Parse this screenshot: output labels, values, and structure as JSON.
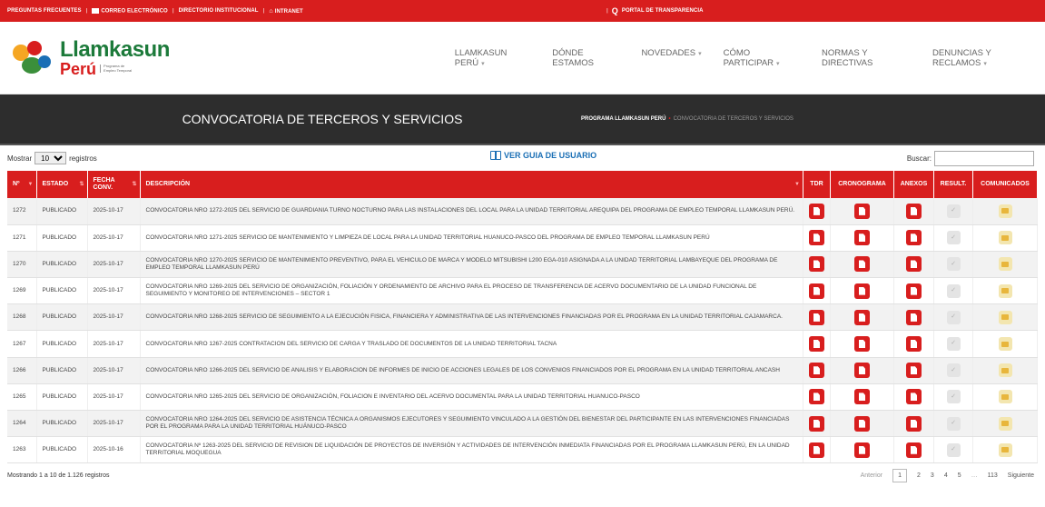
{
  "topbar": {
    "faq": "PREGUNTAS FRECUENTES",
    "email": "CORREO ELECTRÓNICO",
    "directory": "DIRECTORIO INSTITUCIONAL",
    "intranet": "INTRANET",
    "transparency": "PORTAL DE TRANSPARENCIA"
  },
  "logo": {
    "line1": "Llamkasun",
    "line2": "Perú",
    "subtitle": "Programa de Empleo Temporal"
  },
  "nav": [
    {
      "label": "LLAMKASUN PERÚ",
      "has_menu": true
    },
    {
      "label": "DÓNDE ESTAMOS",
      "has_menu": false
    },
    {
      "label": "NOVEDADES",
      "has_menu": true
    },
    {
      "label": "CÓMO PARTICIPAR",
      "has_menu": true
    },
    {
      "label": "NORMAS Y DIRECTIVAS",
      "has_menu": false
    },
    {
      "label": "DENUNCIAS Y RECLAMOS",
      "has_menu": true
    }
  ],
  "banner": {
    "title": "CONVOCATORIA DE TERCEROS Y SERVICIOS",
    "breadcrumb_home": "PROGRAMA LLAMKASUN PERÚ",
    "breadcrumb_current": "CONVOCATORIA DE TERCEROS Y SERVICIOS"
  },
  "controls": {
    "show_label": "Mostrar",
    "page_size": "10",
    "records_label": "registros",
    "guide": "VER GUIA DE USUARIO",
    "search_label": "Buscar:"
  },
  "table": {
    "headers": [
      "Nº",
      "ESTADO",
      "FECHA CONV.",
      "DESCRIPCIÓN",
      "TDR",
      "CRONOGRAMA",
      "ANEXOS",
      "RESULT.",
      "COMUNICADOS"
    ],
    "rows": [
      {
        "num": "1272",
        "estado": "PUBLICADO",
        "fecha": "2025-10-17",
        "desc": "CONVOCATORIA NRO 1272-2025 DEL SERVICIO DE GUARDIANIA TURNO NOCTURNO PARA LAS INSTALACIONES DEL LOCAL PARA LA UNIDAD TERRITORIAL AREQUIPA DEL PROGRAMA DE EMPLEO TEMPORAL LLAMKASUN PERÚ."
      },
      {
        "num": "1271",
        "estado": "PUBLICADO",
        "fecha": "2025-10-17",
        "desc": "CONVOCATORIA NRO 1271-2025 SERVICIO DE MANTENIMIENTO Y LIMPIEZA DE LOCAL PARA LA UNIDAD TERRITORIAL HUANUCO-PASCO DEL PROGRAMA DE EMPLEO TEMPORAL LLAMKASUN PERÚ"
      },
      {
        "num": "1270",
        "estado": "PUBLICADO",
        "fecha": "2025-10-17",
        "desc": "CONVOCATORIA NRO 1270-2025 SERVICIO DE MANTENIMIENTO PREVENTIVO, PARA EL VEHICULO DE MARCA Y MODELO MITSUBISHI L200 EGA-010 ASIGNADA A LA UNIDAD TERRITORIAL LAMBAYEQUE DEL PROGRAMA DE EMPLEO TEMPORAL LLAMKASUN PERÚ"
      },
      {
        "num": "1269",
        "estado": "PUBLICADO",
        "fecha": "2025-10-17",
        "desc": "CONVOCATORIA NRO 1269-2025 DEL SERVICIO DE ORGANIZACIÓN, FOLIACIÓN Y ORDENAMIENTO DE ARCHIVO PARA EL PROCESO DE TRANSFERENCIA DE ACERVO DOCUMENTARIO DE LA UNIDAD FUNCIONAL DE SEGUIMIENTO Y MONITOREO DE INTERVENCIONES – SECTOR 1"
      },
      {
        "num": "1268",
        "estado": "PUBLICADO",
        "fecha": "2025-10-17",
        "desc": "CONVOCATORIA NRO 1268-2025 SERVICIO DE SEGUIMIENTO A LA EJECUCIÓN FISICA, FINANCIERA Y ADMINISTRATIVA DE LAS INTERVENCIONES FINANCIADAS POR EL PROGRAMA EN LA UNIDAD TERRITORIAL CAJAMARCA."
      },
      {
        "num": "1267",
        "estado": "PUBLICADO",
        "fecha": "2025-10-17",
        "desc": "CONVOCATORIA NRO 1267-2025 CONTRATACION DEL SERVICIO DE CARGA Y TRASLADO DE DOCUMENTOS DE LA UNIDAD TERRITORIAL TACNA"
      },
      {
        "num": "1266",
        "estado": "PUBLICADO",
        "fecha": "2025-10-17",
        "desc": "CONVOCATORIA NRO 1266-2025 DEL SERVICIO DE ANALISIS Y ELABORACION DE INFORMES DE INICIO DE ACCIONES LEGALES DE LOS CONVENIOS FINANCIADOS POR EL PROGRAMA EN LA UNIDAD TERRITORIAL ANCASH"
      },
      {
        "num": "1265",
        "estado": "PUBLICADO",
        "fecha": "2025-10-17",
        "desc": "CONVOCATORIA NRO 1265-2025 DEL SERVICIO DE ORGANIZACIÓN, FOLIACION E INVENTARIO DEL ACERVO DOCUMENTAL PARA LA UNIDAD TERRITORIAL HUANUCO-PASCO"
      },
      {
        "num": "1264",
        "estado": "PUBLICADO",
        "fecha": "2025-10-17",
        "desc": "CONVOCATORIA NRO 1264-2025 DEL SERVICIO DE ASISTENCIA TÉCNICA A ORGANISMOS EJECUTORES Y SEGUIMIENTO VINCULADO A LA GESTIÓN DEL BIENESTAR DEL PARTICIPANTE EN LAS INTERVENCIONES FINANCIADAS POR EL PROGRAMA PARA LA UNIDAD TERRITORIAL HUÁNUCO-PASCO"
      },
      {
        "num": "1263",
        "estado": "PUBLICADO",
        "fecha": "2025-10-16",
        "desc": "CONVOCATORIA Nº 1263-2025 DEL SERVICIO DE REVISION DE LIQUIDACIÓN DE PROYECTOS DE INVERSIÓN Y ACTIVIDADES DE INTERVENCIÓN INMEDIATA FINANCIADAS POR EL PROGRAMA LLAMKASUN PERÚ, EN LA UNIDAD TERRITORIAL MOQUEGUA"
      }
    ]
  },
  "footer": {
    "info": "Mostrando 1 a 10 de 1.126 registros",
    "prev": "Anterior",
    "pages": [
      "1",
      "2",
      "3",
      "4",
      "5"
    ],
    "ellipsis": "…",
    "last": "113",
    "next": "Siguiente"
  },
  "colors": {
    "brand_red": "#d81e1e",
    "banner_dark": "#2d2d2d",
    "logo_green": "#1c7a3a"
  }
}
